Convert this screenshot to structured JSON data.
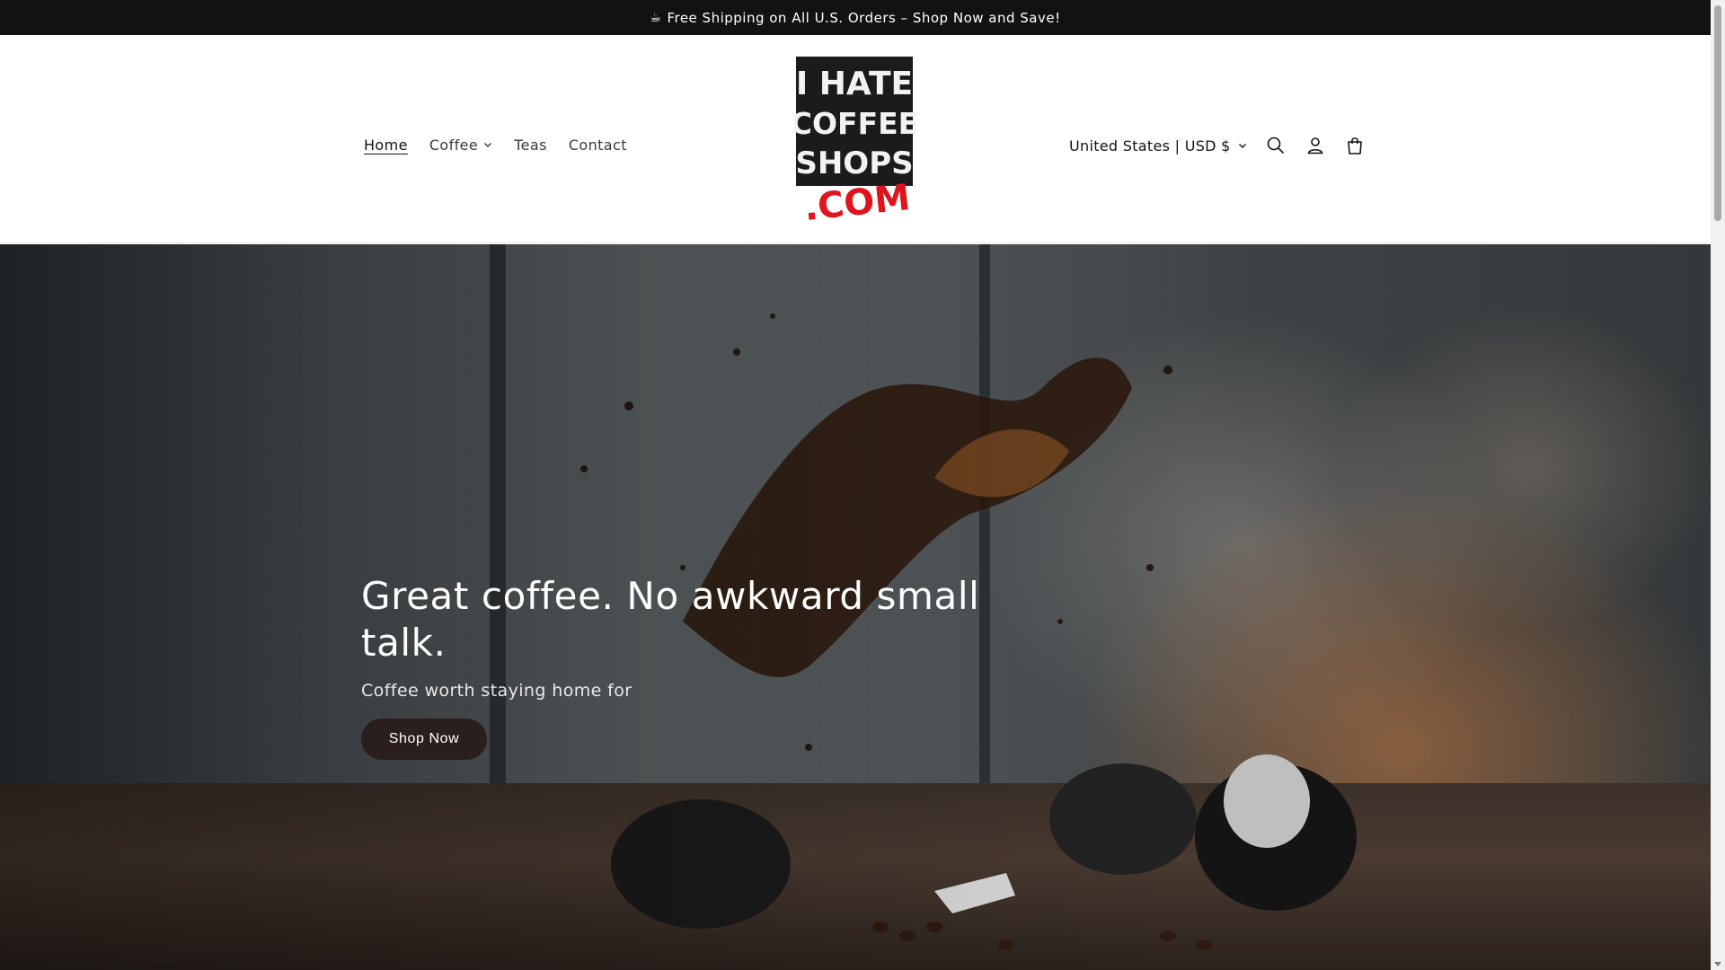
{
  "announcement": {
    "icon": "coffee-cup-icon",
    "text": "Free Shipping on All U.S. Orders – Shop Now and Save!"
  },
  "nav": {
    "items": [
      {
        "label": "Home",
        "active": true,
        "dropdown": false
      },
      {
        "label": "Coffee",
        "active": false,
        "dropdown": true
      },
      {
        "label": "Teas",
        "active": false,
        "dropdown": false
      },
      {
        "label": "Contact",
        "active": false,
        "dropdown": false
      }
    ]
  },
  "logo": {
    "lines": [
      "I HATE",
      "COFFEE",
      "SHOPS"
    ],
    "suffix": ".COM"
  },
  "header_right": {
    "locale": "United States | USD $",
    "icons": [
      "search-icon",
      "account-icon",
      "cart-icon"
    ]
  },
  "hero": {
    "title": "Great coffee. No awkward small talk.",
    "subtitle": "Coffee worth staying home for",
    "cta": "Shop Now"
  },
  "colors": {
    "announcement_bg": "#121212",
    "button_bg": "#2a1f1c",
    "logo_red": "#e0141c"
  }
}
